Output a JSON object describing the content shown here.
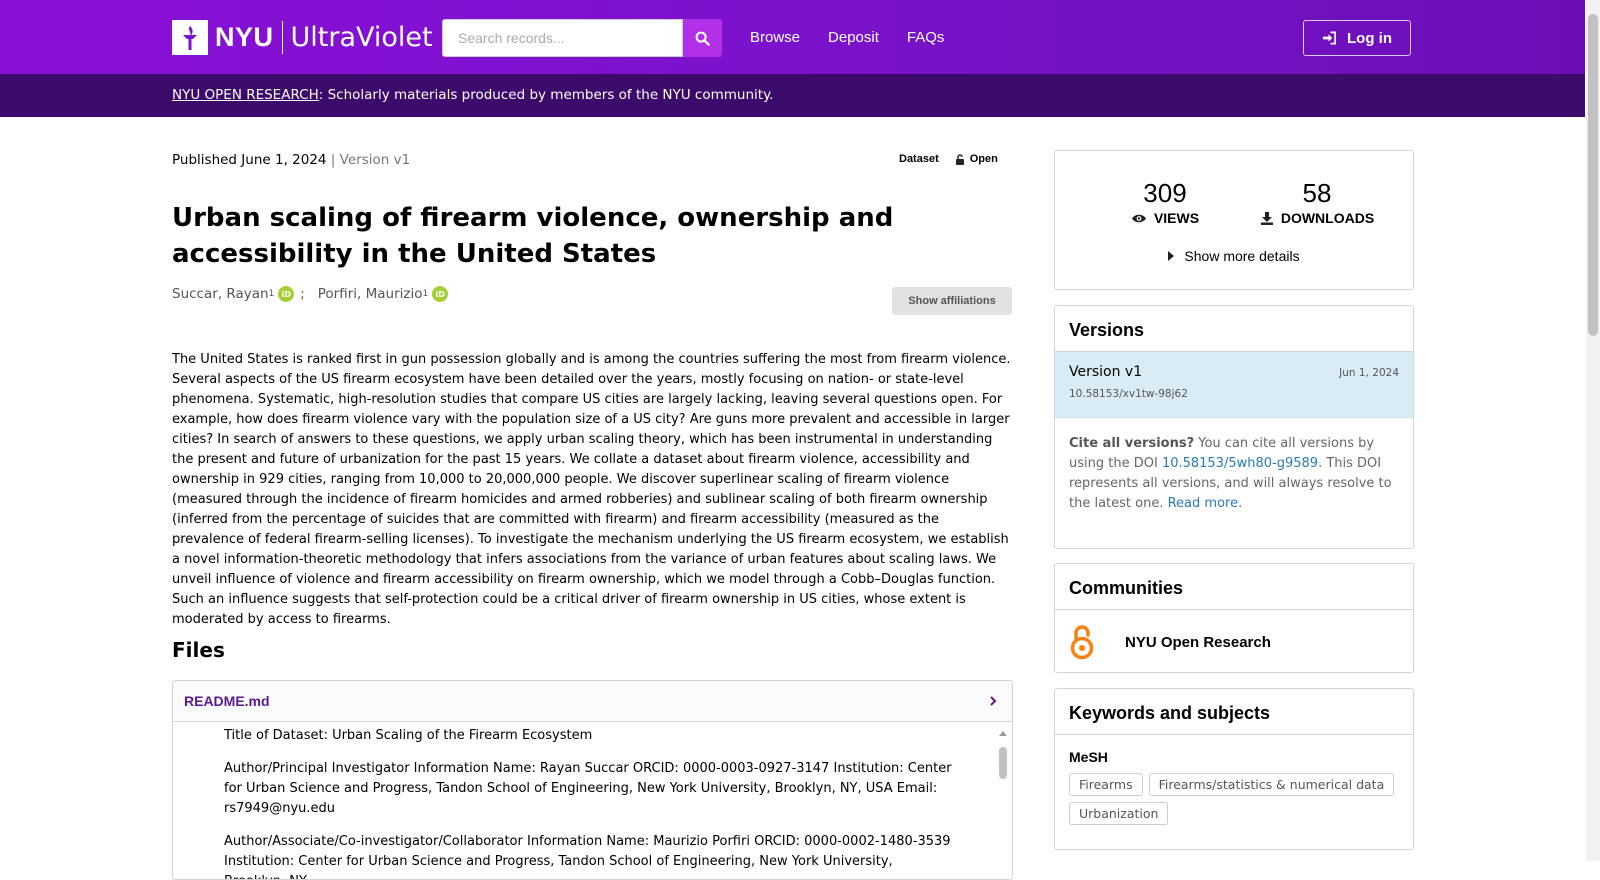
{
  "header": {
    "logo_nyu": "NYU",
    "logo_product": "UltraViolet",
    "search_placeholder": "Search records...",
    "nav": [
      "Browse",
      "Deposit",
      "FAQs"
    ],
    "login_label": "Log in"
  },
  "subbar": {
    "link": "NYU OPEN RESEARCH",
    "text": ": Scholarly materials produced by members of the NYU community."
  },
  "record": {
    "published": "Published June 1, 2024",
    "version": " | Version v1",
    "type": "Dataset",
    "access": "Open",
    "title": "Urban scaling of firearm violence, ownership and accessibility in the United States",
    "authors": [
      {
        "name": "Succar, Rayan",
        "aff": "1",
        "sep": ";"
      },
      {
        "name": "Porfiri, Maurizio",
        "aff": "1",
        "sep": ""
      }
    ],
    "orcid_label": "iD",
    "show_affiliations": "Show affiliations",
    "abstract": "The United States is ranked first in gun possession globally and is among the countries suffering the most from firearm violence. Several aspects of the US firearm ecosystem have been detailed over the years, mostly focusing on nation- or state-level phenomena. Systematic, high-resolution studies that compare US cities are largely lacking, leaving several questions open. For example, how does firearm violence vary with the population size of a US city? Are guns more prevalent and accessible in larger cities? In search of answers to these questions, we apply urban scaling theory, which has been instrumental in understanding the present and future of urbanization for the past 15 years. We collate a dataset about firearm violence, accessibility and ownership in 929 cities, ranging from 10,000 to 20,000,000 people. We discover superlinear scaling of firearm violence (measured through the incidence of firearm homicides and armed robberies) and sublinear scaling of both firearm ownership (inferred from the percentage of suicides that are committed with firearm) and firearm accessibility (measured as the prevalence of federal firearm-selling licenses). To investigate the mechanism underlying the US firearm ecosystem, we establish a novel information-theoretic methodology that infers associations from the variance of urban features about scaling laws. We unveil influence of violence and firearm accessibility on firearm ownership, which we model through a Cobb–Douglas function. Such an influence suggests that self-protection could be a critical driver of firearm ownership in US cities, whose extent is moderated by access to firearms."
  },
  "files": {
    "heading": "Files",
    "readme_name": "README.md",
    "readme_lines": [
      "Title of Dataset: Urban Scaling of the Firearm Ecosystem",
      "Author/Principal Investigator Information Name: Rayan Succar ORCID: 0000-0003-0927-3147 Institution: Center for Urban Science and Progress, Tandon School of Engineering, New York University, Brooklyn, NY, USA Email: rs7949@nyu.edu",
      "Author/Associate/Co-investigator/Collaborator Information Name: Maurizio Porfiri ORCID: 0000-0002-1480-3539 Institution: Center for Urban Science and Progress, Tandon School of Engineering, New York University, Brooklyn, NY"
    ]
  },
  "stats": {
    "views_num": "309",
    "views_label": "VIEWS",
    "downloads_num": "58",
    "downloads_label": "DOWNLOADS",
    "more": "Show more details"
  },
  "versions": {
    "heading": "Versions",
    "items": [
      {
        "label": "Version v1",
        "date": "Jun 1, 2024",
        "doi": "10.58153/xv1tw-98j62"
      }
    ],
    "cite_bold": "Cite all versions?",
    "cite_text1": " You can cite all versions by using the DOI ",
    "cite_doi": "10.58153/5wh80-g9589",
    "cite_text2": ". This DOI represents all versions, and will always resolve to the latest one. ",
    "read_more": "Read more"
  },
  "communities": {
    "heading": "Communities",
    "items": [
      {
        "name": "NYU Open Research"
      }
    ]
  },
  "keywords": {
    "heading": "Keywords and subjects",
    "subheading": "MeSH",
    "chips": [
      "Firearms",
      "Firearms/statistics & numerical data",
      "Urbanization"
    ]
  },
  "colors": {
    "brand_purple": "#8a0fd6",
    "subbar": "#3b0a6b",
    "search_button": "#b230e8",
    "orcid_green": "#a6ce39",
    "open_access_orange": "#f68212"
  }
}
